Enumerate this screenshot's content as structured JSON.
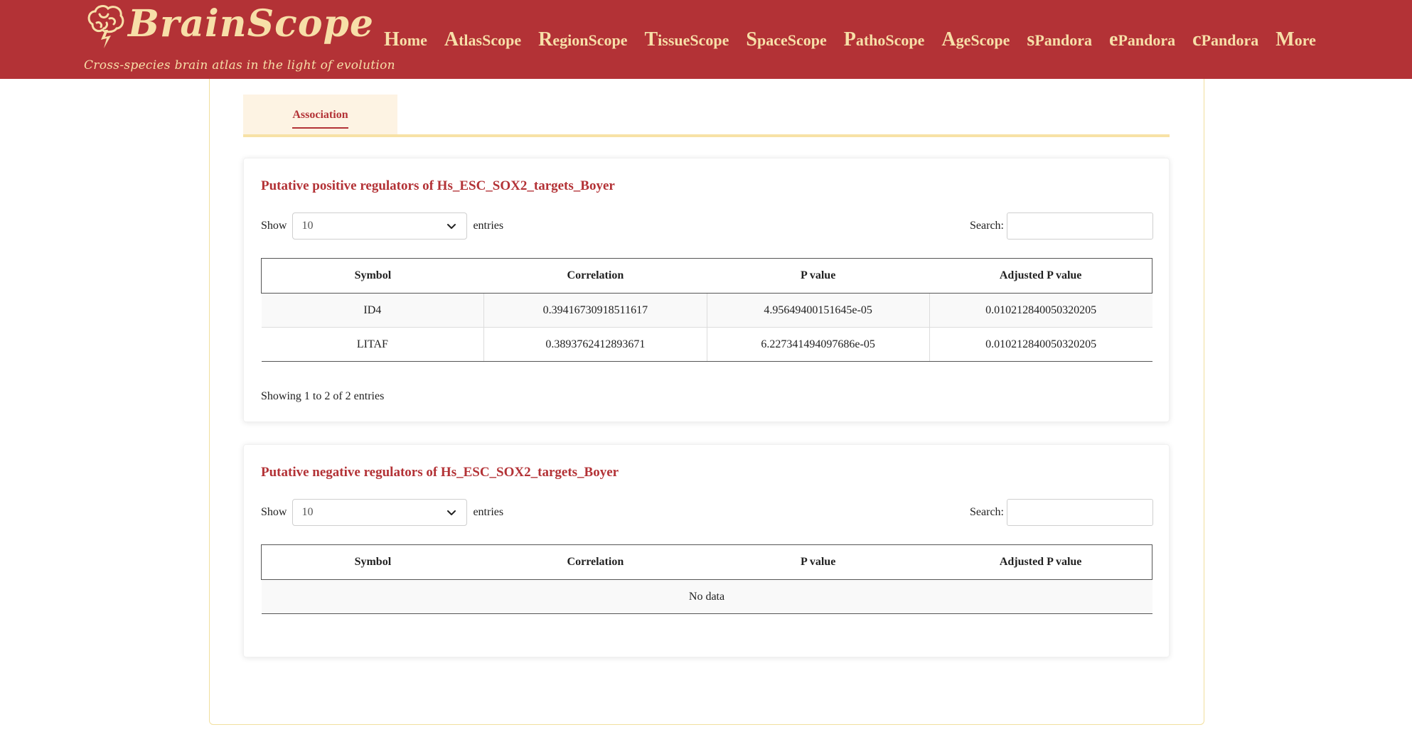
{
  "header": {
    "brand": "BrainScope",
    "tagline": "Cross-species brain atlas in the light of evolution",
    "nav": [
      "Home",
      "AtlasScope",
      "RegionScope",
      "TissueScope",
      "SpaceScope",
      "PathoScope",
      "AgeScope",
      "sPandora",
      "ePandora",
      "cPandora",
      "More"
    ]
  },
  "tabs": [
    {
      "label": "Association",
      "active": true
    }
  ],
  "positive": {
    "title": "Putative positive regulators of Hs_ESC_SOX2_targets_Boyer",
    "show_label": "Show",
    "entries_label": "entries",
    "page_length": "10",
    "search_label": "Search:",
    "columns": [
      "Symbol",
      "Correlation",
      "P value",
      "Adjusted P value"
    ],
    "rows": [
      [
        "ID4",
        "0.39416730918511617",
        "4.95649400151645e-05",
        "0.010212840050320205"
      ],
      [
        "LITAF",
        "0.3893762412893671",
        "6.227341494097686e-05",
        "0.010212840050320205"
      ]
    ],
    "info": "Showing 1 to 2 of 2 entries"
  },
  "negative": {
    "title": "Putative negative regulators of Hs_ESC_SOX2_targets_Boyer",
    "show_label": "Show",
    "entries_label": "entries",
    "page_length": "10",
    "search_label": "Search:",
    "columns": [
      "Symbol",
      "Correlation",
      "P value",
      "Adjusted P value"
    ],
    "empty_text": "No data"
  },
  "colors": {
    "brand_red": "#b33236",
    "brand_cream": "#f7dfa8",
    "tab_underline": "#f7e2a6"
  }
}
